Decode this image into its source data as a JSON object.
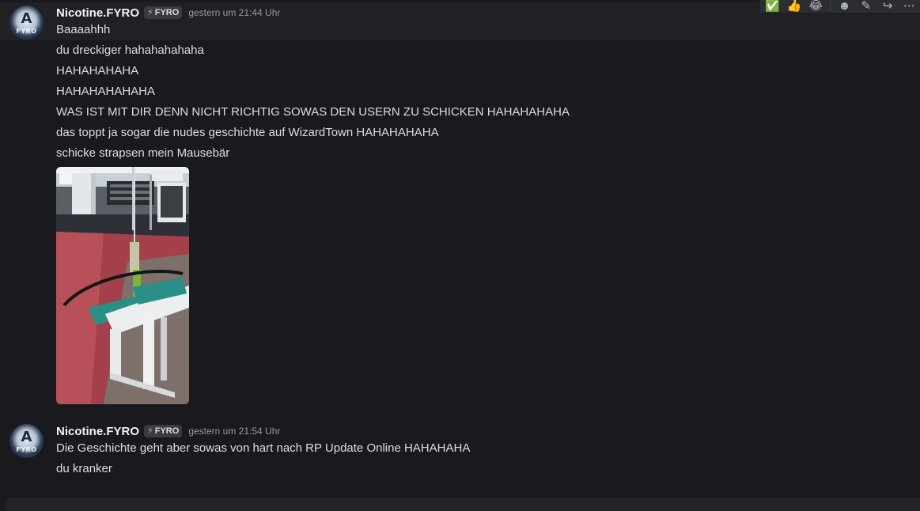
{
  "messages": [
    {
      "author": "Nicotine.FYRO",
      "tag": {
        "icon": "lightning-icon",
        "glyph": "⚡",
        "text": "FYRO"
      },
      "timestamp": "gestern um 21:44 Uhr",
      "lines": [
        "Baaaahhh",
        "du dreckiger hahahahahaha",
        "HAHAHAHAHA",
        "HAHAHAHAHAHA",
        "WAS IST MIT DIR DENN NICHT RICHTIG SOWAS DEN USERN ZU SCHICKEN HAHAHAHAHA",
        "das toppt ja sogar die nudes geschichte auf WizardTown HAHAHAHAHA",
        "schicke strapsen mein Mausebär"
      ],
      "attachment": {
        "type": "image",
        "subject": "gym-cable-machine-photo"
      }
    },
    {
      "author": "Nicotine.FYRO",
      "tag": {
        "icon": "lightning-icon",
        "glyph": "⚡",
        "text": "FYRO"
      },
      "timestamp": "gestern um 21:54 Uhr",
      "lines": [
        "Die Geschichte geht aber sowas von hart nach RP Update Online HAHAHAHA",
        "du kranker"
      ]
    }
  ],
  "avatar": {
    "letter": "A",
    "label": "FYRO"
  },
  "toolbar": {
    "reactions": [
      {
        "icon": "check-mark-emoji",
        "glyph": "✅"
      },
      {
        "icon": "thumbs-up-emoji",
        "glyph": "👍"
      },
      {
        "icon": "laughing-tears-emoji",
        "glyph": "😂"
      }
    ],
    "actions": [
      {
        "icon": "add-reaction-icon",
        "glyph": "☻"
      },
      {
        "icon": "edit-icon",
        "glyph": "✎"
      },
      {
        "icon": "forward-icon",
        "glyph": "↪"
      },
      {
        "icon": "more-options-icon",
        "glyph": "⋯"
      }
    ]
  },
  "colors": {
    "background": "#1a1a1e",
    "hover_background": "#202025",
    "username": "#f2f3f5",
    "message_text": "#dbdee1",
    "timestamp": "#949ba4",
    "tag_background": "#3a3b42",
    "bolt": "#f0b232"
  }
}
